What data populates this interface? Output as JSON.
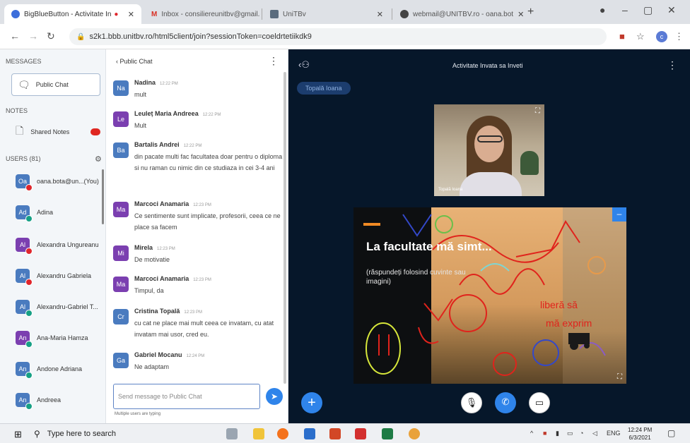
{
  "browser": {
    "tabs": [
      {
        "title": "BigBlueButton - Activitate In",
        "icon_color": "#3c6edb"
      },
      {
        "title": "Inbox - consiliereunitbv@gmail.c",
        "icon_color": "#d93025"
      },
      {
        "title": "UniTBv",
        "icon_color": "#5a6b7d"
      },
      {
        "title": "webmail@UNITBV.ro - oana.bot",
        "icon_color": "#444444"
      }
    ],
    "url": "s2k1.bbb.unitbv.ro/html5client/join?sessionToken=coeldrtetiikdk9",
    "profile_initial": "c"
  },
  "sidebar": {
    "messages_title": "MESSAGES",
    "public_chat_label": "Public Chat",
    "notes_title": "NOTES",
    "shared_notes_label": "Shared Notes",
    "users_title": "USERS (81)",
    "users": [
      {
        "initials": "Oa",
        "name": "oana.bota@un...(You)",
        "color": "#4a7bbf",
        "status_color": "#e0262c"
      },
      {
        "initials": "Ad",
        "name": "Adina",
        "color": "#4a7bbf",
        "status_color": "#16a085"
      },
      {
        "initials": "Al",
        "name": "Alexandra Ungureanu",
        "color": "#7b3fb0",
        "status_color": "#e0262c"
      },
      {
        "initials": "Al",
        "name": "Alexandru Gabriela",
        "color": "#4a7bbf",
        "status_color": "#e0262c"
      },
      {
        "initials": "Al",
        "name": "Alexandru-Gabriel T...",
        "color": "#4a7bbf",
        "status_color": "#16a085"
      },
      {
        "initials": "An",
        "name": "Ana-Maria Hamza",
        "color": "#7b3fb0",
        "status_color": "#16a085"
      },
      {
        "initials": "An",
        "name": "Andone Adriana",
        "color": "#4a7bbf",
        "status_color": "#16a085"
      },
      {
        "initials": "An",
        "name": "Andreea",
        "color": "#4a7bbf",
        "status_color": "#16a085"
      }
    ]
  },
  "chat": {
    "back_label": "‹ Public Chat",
    "messages": [
      {
        "initials": "Na",
        "color": "#4a7bbf",
        "name": "Nadina",
        "time": "12:22 PM",
        "text": "mult"
      },
      {
        "initials": "Le",
        "color": "#7b3fb0",
        "name": "Leuleț Maria Andreea",
        "time": "12:22 PM",
        "text": "Mult"
      },
      {
        "initials": "Ba",
        "color": "#4a7bbf",
        "name": "Bartalis Andrei",
        "time": "12:22 PM",
        "text": "din pacate multi fac facultatea doar pentru o diploma si nu raman cu nimic din ce studiaza in cei 3-4 ani"
      },
      {
        "initials": "Ma",
        "color": "#7b3fb0",
        "name": "Marcoci Anamaria",
        "time": "12:23 PM",
        "text": "Ce sentimente sunt implicate, profesorii, ceea ce ne place sa facem"
      },
      {
        "initials": "Mi",
        "color": "#7b3fb0",
        "name": "Mirela",
        "time": "12:23 PM",
        "text": "De motivatie"
      },
      {
        "initials": "Ma",
        "color": "#7b3fb0",
        "name": "Marcoci Anamaria",
        "time": "12:23 PM",
        "text": "Timpul, da"
      },
      {
        "initials": "Cr",
        "color": "#4a7bbf",
        "name": "Cristina Topală",
        "time": "12:23 PM",
        "text": "cu cat ne place mai mult ceea ce invatam, cu atat invatam mai usor, cred eu."
      },
      {
        "initials": "Ga",
        "color": "#4a7bbf",
        "name": "Gabriel Mocanu",
        "time": "12:24 PM",
        "text": "Ne adaptam"
      }
    ],
    "input_placeholder": "Send message to Public Chat",
    "typing_text": "Multiple users are typing"
  },
  "presentation": {
    "meeting_title": "Activitate Invata sa Inveti",
    "talker": "Topală Ioana",
    "webcam_name": "Topală Ioana",
    "slide_title": "La facultate mă simt...",
    "slide_subtitle": "(răspundeți folosind cuvinte sau imagini)",
    "annotations": [
      "liberă să",
      "mă exprim"
    ]
  },
  "taskbar": {
    "search_placeholder": "Type here to search",
    "language": "ENG",
    "time": "12:24 PM",
    "date": "6/3/2021"
  }
}
